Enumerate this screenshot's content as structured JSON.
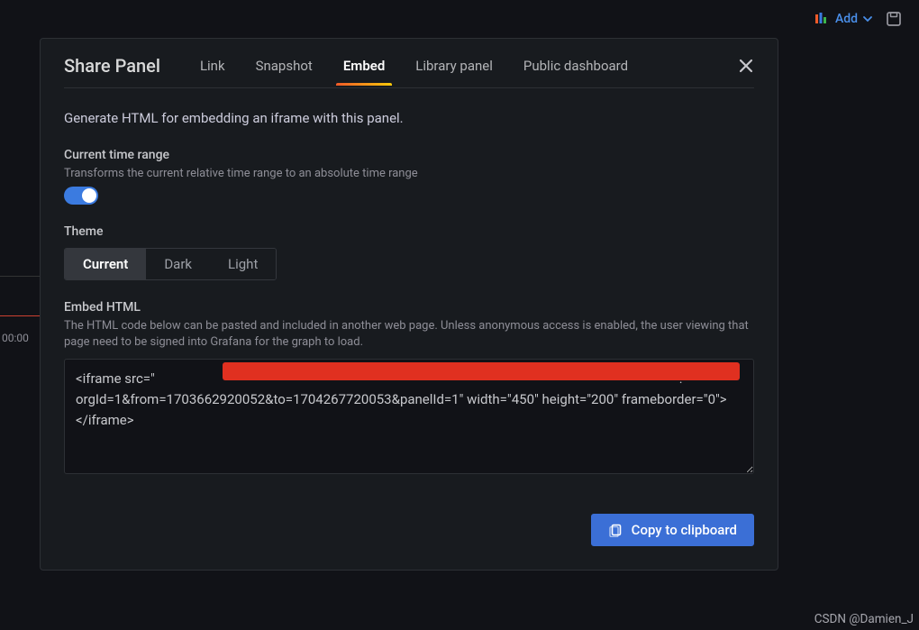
{
  "toolbar": {
    "add_label": "Add"
  },
  "bg": {
    "time": "00:00"
  },
  "modal": {
    "title": "Share Panel",
    "tabs": {
      "link": "Link",
      "snapshot": "Snapshot",
      "embed": "Embed",
      "library": "Library panel",
      "public": "Public dashboard"
    },
    "body": {
      "intro": "Generate HTML for embedding an iframe with this panel.",
      "time_range": {
        "label": "Current time range",
        "help": "Transforms the current relative time range to an absolute time range",
        "enabled": true
      },
      "theme": {
        "label": "Theme",
        "options": {
          "current": "Current",
          "dark": "Dark",
          "light": "Light"
        },
        "selected": "current"
      },
      "embed_html": {
        "label": "Embed HTML",
        "help": "The HTML code below can be pasted and included in another web page. Unless anonymous access is enabled, the user viewing that page need to be signed into Grafana for the graph to load.",
        "value": "<iframe src=\"                                                                                                                                                            ?orgId=1&from=1703662920052&to=1704267720053&panelId=1\" width=\"450\" height=\"200\" frameborder=\"0\"></iframe>"
      }
    },
    "footer": {
      "copy_label": "Copy to clipboard"
    }
  },
  "watermark": "CSDN @Damien_J"
}
